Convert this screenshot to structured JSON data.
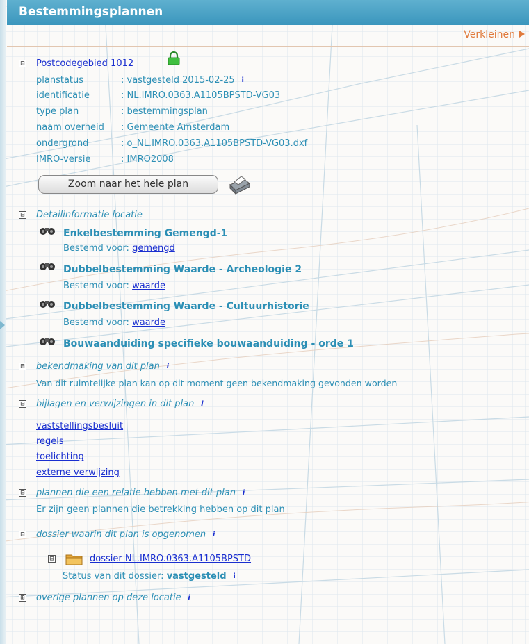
{
  "header": {
    "title": "Bestemmingsplannen",
    "shrink_label": "Verkleinen"
  },
  "plan": {
    "title": "Postcodegebied 1012",
    "attributes": [
      {
        "label": "planstatus",
        "value": ": vastgesteld 2015-02-25",
        "has_info": true
      },
      {
        "label": "identificatie",
        "value": ": NL.IMRO.0363.A1105BPSTD-VG03",
        "has_info": false
      },
      {
        "label": "type plan",
        "value": ": bestemmingsplan",
        "has_info": false
      },
      {
        "label": "naam overheid",
        "value": ": Gemeente Amsterdam",
        "has_info": false
      },
      {
        "label": "ondergrond",
        "value": ": o_NL.IMRO.0363.A1105BPSTD-VG03.dxf",
        "has_info": false
      },
      {
        "label": "IMRO-versie",
        "value": ": IMRO2008",
        "has_info": false
      }
    ],
    "zoom_button": "Zoom naar het hele plan"
  },
  "detail": {
    "heading": "Detailinformatie locatie",
    "items": [
      {
        "title": "Enkelbestemming Gemengd-1",
        "prefix": "Bestemd voor:",
        "link": "gemengd"
      },
      {
        "title": "Dubbelbestemming Waarde - Archeologie 2",
        "prefix": "Bestemd voor:",
        "link": "waarde"
      },
      {
        "title": "Dubbelbestemming Waarde - Cultuurhistorie",
        "prefix": "Bestemd voor:",
        "link": "waarde"
      },
      {
        "title": "Bouwaanduiding specifieke bouwaanduiding - orde 1"
      }
    ]
  },
  "bekendmaking": {
    "heading": "bekendmaking van dit plan",
    "text": "Van dit ruimtelijke plan kan op dit moment geen bekendmaking gevonden worden"
  },
  "bijlagen": {
    "heading": "bijlagen en verwijzingen in dit plan",
    "links": [
      "vaststellingsbesluit",
      "regels",
      "toelichting",
      "externe verwijzing"
    ]
  },
  "relaties": {
    "heading": "plannen die een relatie hebben met dit plan",
    "text": "Er zijn geen plannen die betrekking hebben op dit plan"
  },
  "dossier": {
    "heading": "dossier waarin dit plan is opgenomen",
    "link": "dossier NL.IMRO.0363.A1105BPSTD",
    "status_label": "Status van dit dossier:",
    "status_value": "vastgesteld"
  },
  "overige": {
    "heading": "overige plannen op deze locatie"
  },
  "icons": {
    "collapse": "⊟",
    "expand": "⊞",
    "info": "i",
    "lock": "lock-icon",
    "binoculars": "binoculars-icon",
    "printer": "printer-icon",
    "folder": "folder-icon"
  },
  "colors": {
    "header": "#4aa5c8",
    "text": "#2c8fb5",
    "link": "#1a2fd0",
    "shrink": "#e07a3c"
  }
}
